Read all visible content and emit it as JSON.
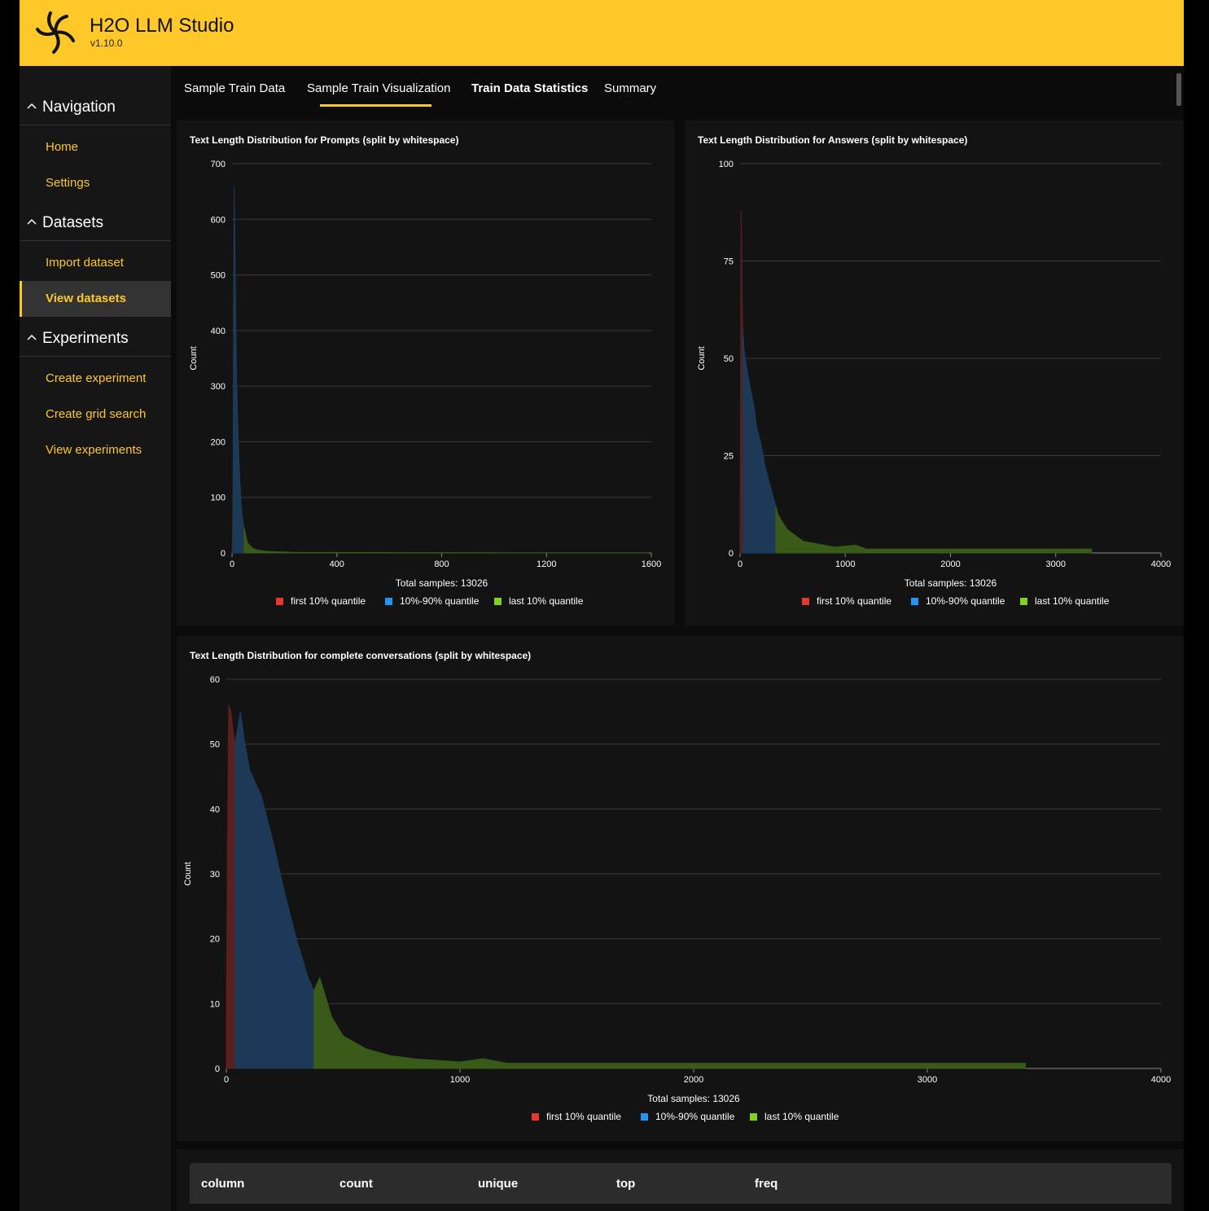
{
  "header": {
    "title": "H2O LLM Studio",
    "version": "v1.10.0"
  },
  "sidebar": {
    "sections": [
      {
        "label": "Navigation",
        "items": [
          {
            "label": "Home"
          },
          {
            "label": "Settings"
          }
        ]
      },
      {
        "label": "Datasets",
        "items": [
          {
            "label": "Import dataset"
          },
          {
            "label": "View datasets",
            "active": true
          }
        ]
      },
      {
        "label": "Experiments",
        "items": [
          {
            "label": "Create experiment"
          },
          {
            "label": "Create grid search"
          },
          {
            "label": "View experiments"
          }
        ]
      }
    ]
  },
  "tabs": [
    {
      "label": "Sample Train Data"
    },
    {
      "label": "Sample Train Visualization"
    },
    {
      "label": "Train Data Statistics",
      "active": true
    },
    {
      "label": "Summary"
    }
  ],
  "colors": {
    "accent": "#fec828",
    "first_quantile": "#e5372f",
    "mid_quantile": "#2196f3",
    "last_quantile": "#7ed321"
  },
  "chart_data": [
    {
      "type": "area",
      "title": "Text Length Distribution for Prompts (split by whitespace)",
      "ylabel": "Count",
      "xlabel": "Total samples: 13026",
      "xlim": [
        0,
        1600
      ],
      "ylim": [
        0,
        700
      ],
      "xticks": [
        0,
        400,
        800,
        1200,
        1600
      ],
      "yticks": [
        0,
        100,
        200,
        300,
        400,
        500,
        600,
        700
      ],
      "legend": [
        "first 10% quantile",
        "10%-90% quantile",
        "last 10% quantile"
      ],
      "series": [
        {
          "name": "first 10% quantile",
          "x": [
            0,
            1,
            2
          ],
          "y": [
            0,
            8,
            30
          ]
        },
        {
          "name": "10%-90% quantile",
          "x": [
            2,
            4,
            6,
            8,
            10,
            14,
            18,
            24,
            30,
            36,
            42,
            46
          ],
          "y": [
            30,
            120,
            450,
            660,
            600,
            430,
            300,
            200,
            130,
            80,
            55,
            45
          ]
        },
        {
          "name": "last 10% quantile",
          "x": [
            46,
            50,
            55,
            60,
            70,
            80,
            100,
            130,
            180,
            250,
            400,
            800,
            1200,
            1590
          ],
          "y": [
            45,
            38,
            25,
            18,
            12,
            8,
            5,
            3,
            2,
            1,
            1,
            0.5,
            0.3,
            0.3
          ]
        }
      ]
    },
    {
      "type": "area",
      "title": "Text Length Distribution for Answers (split by whitespace)",
      "ylabel": "Count",
      "xlabel": "Total samples: 13026",
      "xlim": [
        0,
        4000
      ],
      "ylim": [
        0,
        100
      ],
      "xticks": [
        0,
        1000,
        2000,
        3000,
        4000
      ],
      "yticks": [
        0,
        25,
        50,
        75,
        100
      ],
      "legend": [
        "first 10% quantile",
        "10%-90% quantile",
        "last 10% quantile"
      ],
      "series": [
        {
          "name": "first 10% quantile",
          "x": [
            0,
            5,
            10,
            15,
            20,
            25
          ],
          "y": [
            5,
            50,
            88,
            80,
            65,
            58
          ]
        },
        {
          "name": "10%-90% quantile",
          "x": [
            25,
            40,
            60,
            80,
            100,
            130,
            160,
            200,
            240,
            280,
            320,
            340
          ],
          "y": [
            58,
            52,
            48,
            45,
            42,
            38,
            32,
            28,
            22,
            18,
            14,
            12
          ]
        },
        {
          "name": "last 10% quantile",
          "x": [
            340,
            360,
            400,
            450,
            500,
            600,
            700,
            800,
            900,
            1100,
            1200,
            2000,
            3000,
            3340
          ],
          "y": [
            12,
            10,
            8,
            6,
            5,
            3,
            2.5,
            2,
            1.5,
            2,
            1,
            1,
            1,
            1
          ]
        }
      ]
    },
    {
      "type": "area",
      "title": "Text Length Distribution for complete conversations (split by whitespace)",
      "ylabel": "Count",
      "xlabel": "Total samples: 13026",
      "xlim": [
        0,
        4000
      ],
      "ylim": [
        0,
        60
      ],
      "xticks": [
        0,
        1000,
        2000,
        3000,
        4000
      ],
      "yticks": [
        0,
        10,
        20,
        30,
        40,
        50,
        60
      ],
      "legend": [
        "first 10% quantile",
        "10%-90% quantile",
        "last 10% quantile"
      ],
      "series": [
        {
          "name": "first 10% quantile",
          "x": [
            0,
            5,
            10,
            20,
            30,
            37
          ],
          "y": [
            8,
            35,
            56,
            55,
            52,
            50
          ]
        },
        {
          "name": "10%-90% quantile",
          "x": [
            37,
            60,
            80,
            100,
            150,
            200,
            250,
            300,
            350,
            375
          ],
          "y": [
            50,
            55,
            50,
            46,
            42,
            35,
            27,
            20,
            14,
            12
          ]
        },
        {
          "name": "last 10% quantile",
          "x": [
            375,
            400,
            450,
            500,
            600,
            700,
            800,
            1000,
            1100,
            1200,
            2000,
            3000,
            3420
          ],
          "y": [
            12,
            14,
            8,
            5,
            3,
            2,
            1.5,
            1,
            1.5,
            0.8,
            0.8,
            0.8,
            0.8
          ]
        }
      ]
    }
  ],
  "table": {
    "columns": [
      "column",
      "count",
      "unique",
      "top",
      "freq"
    ]
  }
}
